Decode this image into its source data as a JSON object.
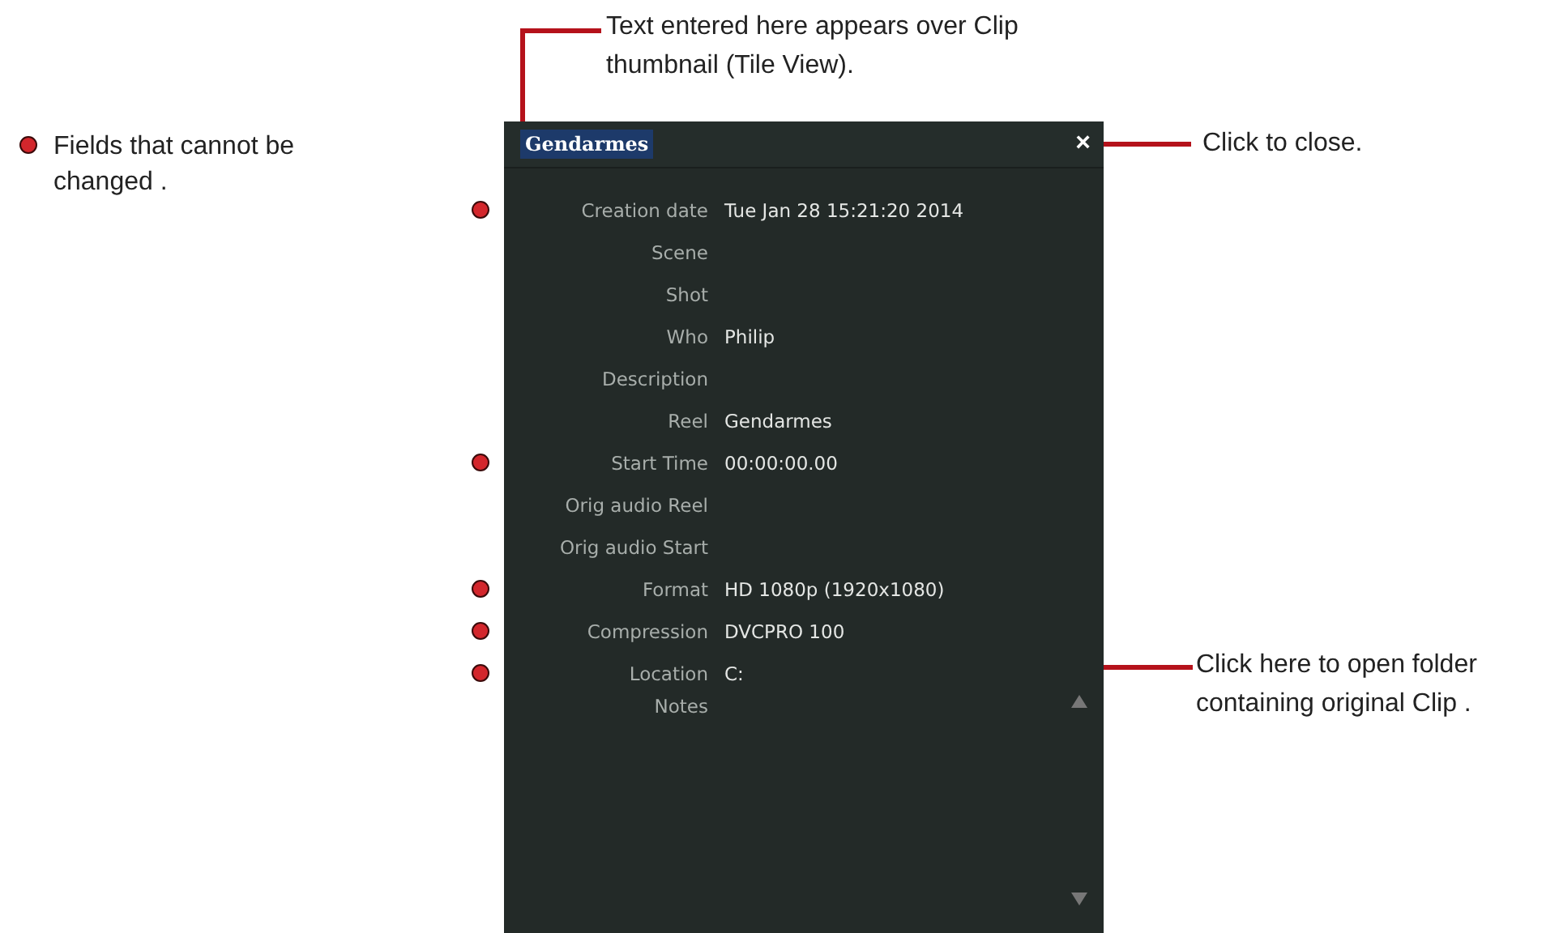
{
  "legend": {
    "text": "Fields that cannot be changed ."
  },
  "callouts": [
    {
      "kind": "title",
      "text": "Text entered here appears over Clip thumbnail (Tile View)."
    },
    {
      "kind": "close",
      "text": "Click to close."
    },
    {
      "kind": "location",
      "text": "Click here to open folder containing original Clip ."
    }
  ],
  "panel": {
    "title": "Gendarmes",
    "close": "×",
    "fields": [
      {
        "label": "Creation date",
        "value": "Tue Jan 28 15:21:20 2014",
        "locked": true
      },
      {
        "label": "Scene",
        "locked": false
      },
      {
        "label": "Shot",
        "locked": false
      },
      {
        "label": "Who",
        "value": "Philip",
        "locked": false
      },
      {
        "label": "Description",
        "locked": false
      },
      {
        "label": "Reel",
        "value": "Gendarmes",
        "locked": false
      },
      {
        "label": "Start Time",
        "value": "00:00:00.00",
        "locked": true
      },
      {
        "label": "Orig audio Reel",
        "locked": false
      },
      {
        "label": "Orig audio Start",
        "locked": false
      },
      {
        "label": "Format",
        "value": "HD 1080p (1920x1080)",
        "locked": true
      },
      {
        "label": "Compression",
        "value": "DVCPRO 100",
        "locked": true
      },
      {
        "label": "Location",
        "value": "C:",
        "locked": true
      },
      {
        "label": "Notes",
        "kind": "notes",
        "locked": false
      }
    ]
  }
}
